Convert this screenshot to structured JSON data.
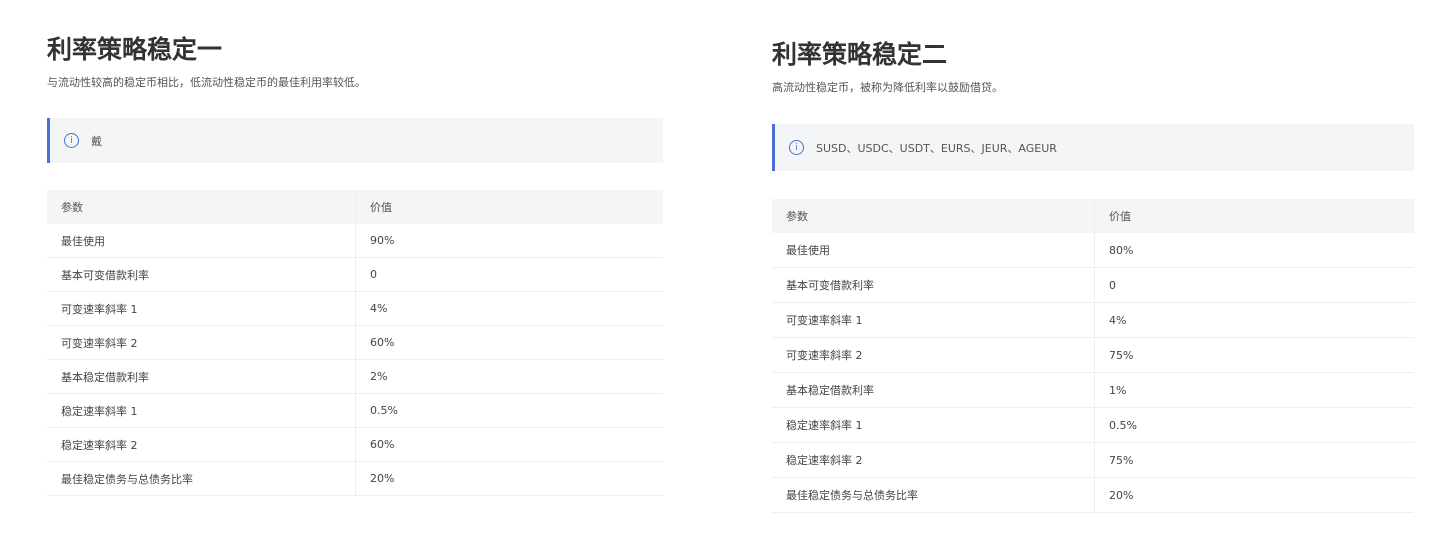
{
  "panels": [
    {
      "title": "利率策略稳定一",
      "subtitle": "与流动性较高的稳定币相比，低流动性稳定币的最佳利用率较低。",
      "callout": "戴",
      "headers": [
        "参数",
        "价值"
      ],
      "rows": [
        [
          "最佳使用",
          "90%"
        ],
        [
          "基本可变借款利率",
          "0"
        ],
        [
          "可变速率斜率 1",
          "4%"
        ],
        [
          "可变速率斜率 2",
          "60%"
        ],
        [
          "基本稳定借款利率",
          "2%"
        ],
        [
          "稳定速率斜率 1",
          "0.5%"
        ],
        [
          "稳定速率斜率 2",
          "60%"
        ],
        [
          "最佳稳定债务与总债务比率",
          "20%"
        ]
      ]
    },
    {
      "title": "利率策略稳定二",
      "subtitle": "高流动性稳定币，被称为降低利率以鼓励借贷。",
      "callout": "SUSD、USDC、USDT、EURS、JEUR、AGEUR",
      "headers": [
        "参数",
        "价值"
      ],
      "rows": [
        [
          "最佳使用",
          "80%"
        ],
        [
          "基本可变借款利率",
          "0"
        ],
        [
          "可变速率斜率 1",
          "4%"
        ],
        [
          "可变速率斜率 2",
          "75%"
        ],
        [
          "基本稳定借款利率",
          "1%"
        ],
        [
          "稳定速率斜率 1",
          "0.5%"
        ],
        [
          "稳定速率斜率 2",
          "75%"
        ],
        [
          "最佳稳定债务与总债务比率",
          "20%"
        ]
      ]
    }
  ],
  "colors": {
    "accent": "#4a6fd8",
    "callout_bg": "#f4f5f7"
  }
}
